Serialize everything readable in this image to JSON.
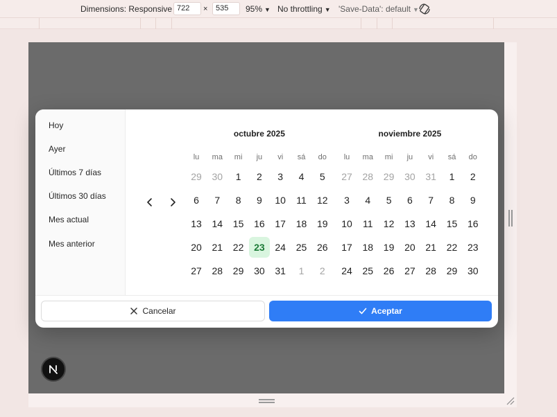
{
  "devtools": {
    "dimensions_label": "Dimensions: Responsive",
    "width": "722",
    "times": "×",
    "height": "535",
    "zoom": "95%",
    "throttling": "No throttling",
    "save_data": "'Save-Data': default",
    "caret": "▼"
  },
  "dialog": {
    "presets": [
      "Hoy",
      "Ayer",
      "Últimos 7 días",
      "Últimos 30 días",
      "Mes actual",
      "Mes anterior"
    ],
    "weekdays": [
      "lu",
      "ma",
      "mi",
      "ju",
      "vi",
      "sá",
      "do"
    ],
    "months": [
      {
        "title": "octubre 2025",
        "weeks": [
          [
            [
              "29",
              1
            ],
            [
              "30",
              1
            ],
            [
              "1",
              0
            ],
            [
              "2",
              0
            ],
            [
              "3",
              0
            ],
            [
              "4",
              0
            ],
            [
              "5",
              0
            ]
          ],
          [
            [
              "6",
              0
            ],
            [
              "7",
              0
            ],
            [
              "8",
              0
            ],
            [
              "9",
              0
            ],
            [
              "10",
              0
            ],
            [
              "11",
              0
            ],
            [
              "12",
              0
            ]
          ],
          [
            [
              "13",
              0
            ],
            [
              "14",
              0
            ],
            [
              "15",
              0
            ],
            [
              "16",
              0
            ],
            [
              "17",
              0
            ],
            [
              "18",
              0
            ],
            [
              "19",
              0
            ]
          ],
          [
            [
              "20",
              0
            ],
            [
              "21",
              0
            ],
            [
              "22",
              0
            ],
            [
              "23",
              2
            ],
            [
              "24",
              0
            ],
            [
              "25",
              0
            ],
            [
              "26",
              0
            ]
          ],
          [
            [
              "27",
              0
            ],
            [
              "28",
              0
            ],
            [
              "29",
              0
            ],
            [
              "30",
              0
            ],
            [
              "31",
              0
            ],
            [
              "1",
              1
            ],
            [
              "2",
              1
            ]
          ]
        ]
      },
      {
        "title": "noviembre 2025",
        "weeks": [
          [
            [
              "27",
              1
            ],
            [
              "28",
              1
            ],
            [
              "29",
              1
            ],
            [
              "30",
              1
            ],
            [
              "31",
              1
            ],
            [
              "1",
              0
            ],
            [
              "2",
              0
            ]
          ],
          [
            [
              "3",
              0
            ],
            [
              "4",
              0
            ],
            [
              "5",
              0
            ],
            [
              "6",
              0
            ],
            [
              "7",
              0
            ],
            [
              "8",
              0
            ],
            [
              "9",
              0
            ]
          ],
          [
            [
              "10",
              0
            ],
            [
              "11",
              0
            ],
            [
              "12",
              0
            ],
            [
              "13",
              0
            ],
            [
              "14",
              0
            ],
            [
              "15",
              0
            ],
            [
              "16",
              0
            ]
          ],
          [
            [
              "17",
              0
            ],
            [
              "18",
              0
            ],
            [
              "19",
              0
            ],
            [
              "20",
              0
            ],
            [
              "21",
              0
            ],
            [
              "22",
              0
            ],
            [
              "23",
              0
            ]
          ],
          [
            [
              "24",
              0
            ],
            [
              "25",
              0
            ],
            [
              "26",
              0
            ],
            [
              "27",
              0
            ],
            [
              "28",
              0
            ],
            [
              "29",
              0
            ],
            [
              "30",
              0
            ]
          ]
        ]
      }
    ],
    "cancel_label": "Cancelar",
    "accept_label": "Aceptar"
  },
  "colors": {
    "accent": "#2f7df6",
    "selected_bg": "#d9f5df",
    "selected_text": "#1b7a36"
  },
  "icons": [
    "chevron-left-icon",
    "chevron-right-icon",
    "close-icon",
    "check-icon",
    "rotate-icon",
    "nextjs-logo-icon"
  ]
}
